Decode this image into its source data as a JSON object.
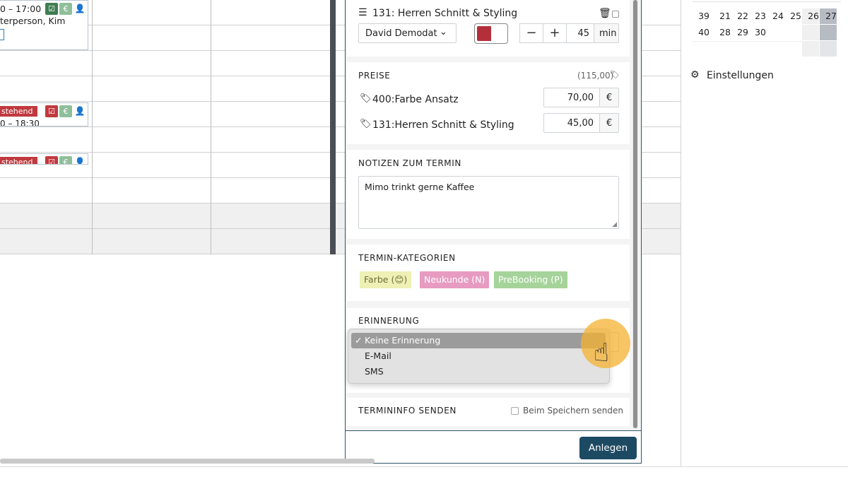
{
  "background_calendar": {
    "appointment1": {
      "time": "0 – 17:00",
      "person": "terperson, Kim"
    },
    "appointment2": {
      "status": "stehend",
      "time": "0 – 18:30"
    },
    "appointment3": {
      "status": "stehend"
    },
    "icon_euro": "€"
  },
  "modal": {
    "service_row": {
      "title": "131: Herren Schnitt & Styling",
      "staff": "David Demodat",
      "duration": "45",
      "unit": "min",
      "minus": "−",
      "plus": "+"
    },
    "prices": {
      "title": "PREISE",
      "total": "(115,00)",
      "items": [
        {
          "label": "400:Farbe Ansatz",
          "value": "70,00",
          "currency": "€"
        },
        {
          "label": "131:Herren Schnitt & Styling",
          "value": "45,00",
          "currency": "€"
        }
      ]
    },
    "notes": {
      "title": "NOTIZEN ZUM TERMIN",
      "value": "Mimo trinkt gerne Kaffee"
    },
    "categories": {
      "title": "TERMIN-KATEGORIEN",
      "items": [
        {
          "label": "Farbe (😊)",
          "bg": "#eef0b5",
          "fg": "#6e6e3a"
        },
        {
          "label": "Neukunde (N)",
          "bg": "#e79bc1",
          "fg": "#ffffff"
        },
        {
          "label": "PreBooking (P)",
          "bg": "#a6d39a",
          "fg": "#ffffff"
        }
      ]
    },
    "reminder": {
      "title": "ERINNERUNG",
      "options": [
        {
          "label": "Keine Erinnerung",
          "check": "✓"
        },
        {
          "label": "E-Mail"
        },
        {
          "label": "SMS"
        }
      ]
    },
    "terminfo": {
      "title": "TERMININFO SENDEN",
      "checkbox_label": "Beim Speichern senden"
    },
    "submit_label": "Anlegen"
  },
  "right_panel": {
    "calendar_rows": [
      {
        "week": "39",
        "days": [
          "21",
          "22",
          "23",
          "24",
          "25",
          "26",
          "27"
        ]
      },
      {
        "week": "40",
        "days": [
          "28",
          "29",
          "30",
          "",
          "",
          "",
          ""
        ]
      }
    ],
    "settings_label": "Einstellungen"
  },
  "colors": {
    "primary": "#1d4a63",
    "selected_color_swatch": "#b3303a"
  }
}
